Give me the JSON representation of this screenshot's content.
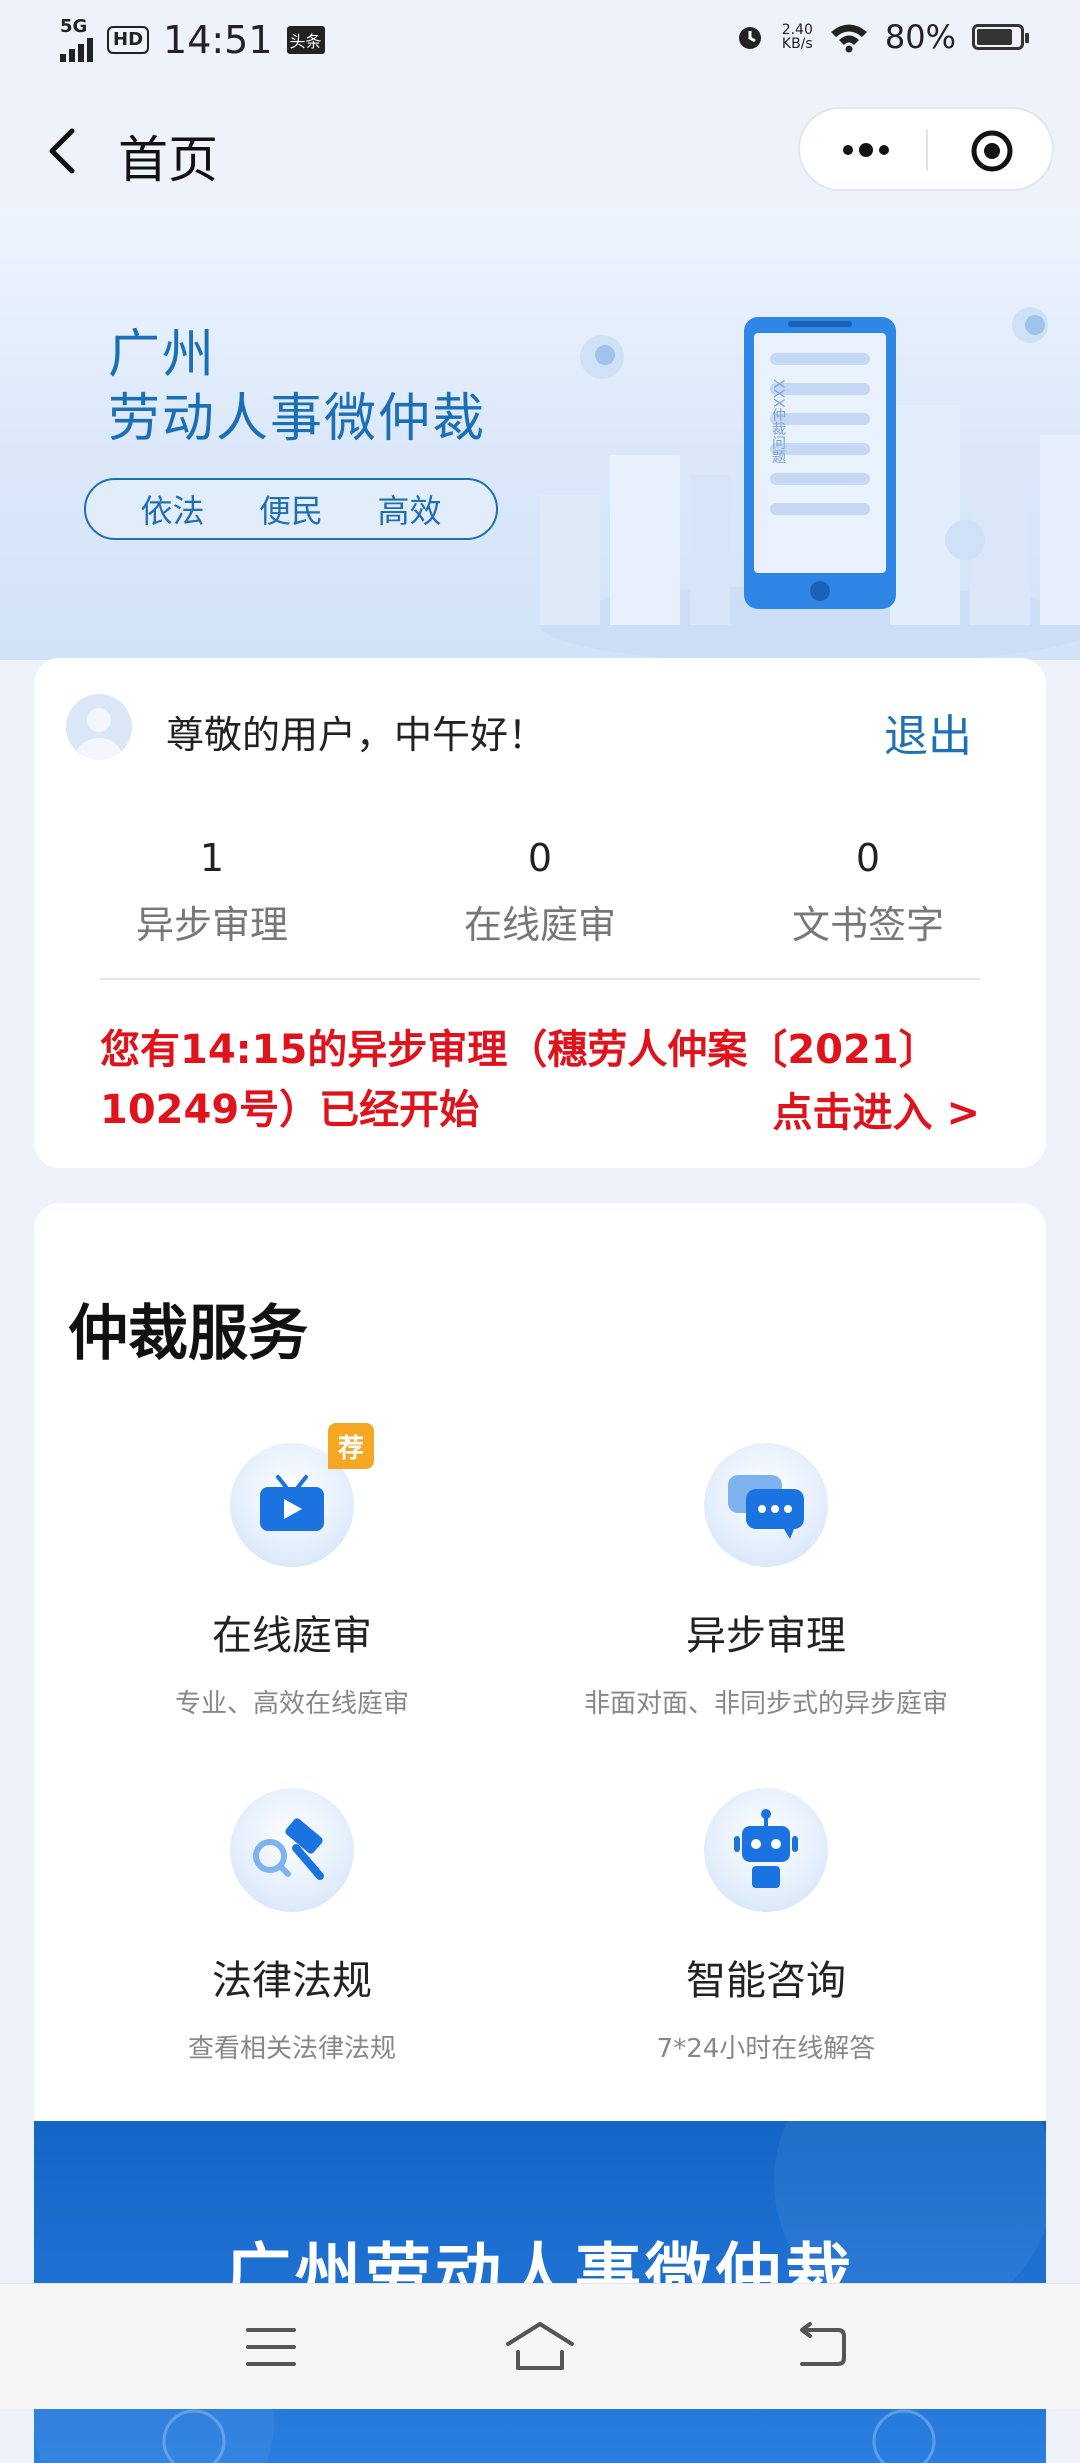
{
  "status_bar": {
    "network": "5G",
    "hd": "HD",
    "time": "14:51",
    "app_badge": "头条",
    "net_speed_value": "2.40",
    "net_speed_unit": "KB/s",
    "battery": "80%"
  },
  "nav": {
    "title": "首页",
    "icons": [
      "back-icon",
      "more-icon",
      "close-target-icon"
    ]
  },
  "banner": {
    "title_line1": "广州",
    "title_line2": "劳动人事微仲裁",
    "tags": [
      "依法",
      "便民",
      "高效"
    ],
    "phone_text": "XXX仲裁问题"
  },
  "user_card": {
    "greeting": "尊敬的用户，中午好！",
    "logout_label": "退出",
    "stats": [
      {
        "value": "1",
        "label": "异步审理"
      },
      {
        "value": "0",
        "label": "在线庭审"
      },
      {
        "value": "0",
        "label": "文书签字"
      }
    ],
    "notice": "您有14:15的异步审理（穗劳人仲案〔2021〕10249号）已经开始",
    "enter_label": "点击进入 >"
  },
  "services": {
    "title": "仲裁服务",
    "items": [
      {
        "name": "在线庭审",
        "desc": "专业、高效在线庭审",
        "icon": "tv-play-icon",
        "badge": "荐"
      },
      {
        "name": "异步审理",
        "desc": "非面对面、非同步式的异步庭审",
        "icon": "chat-bubble-icon"
      },
      {
        "name": "法律法规",
        "desc": "查看相关法律法规",
        "icon": "gavel-icon"
      },
      {
        "name": "智能咨询",
        "desc": "7*24小时在线解答",
        "icon": "robot-icon"
      }
    ]
  },
  "promo": {
    "title": "广州劳动人事微仲裁"
  },
  "colors": {
    "brand_blue": "#1d71b8",
    "alert_red": "#e0121b",
    "badge_orange": "#f5a623"
  }
}
